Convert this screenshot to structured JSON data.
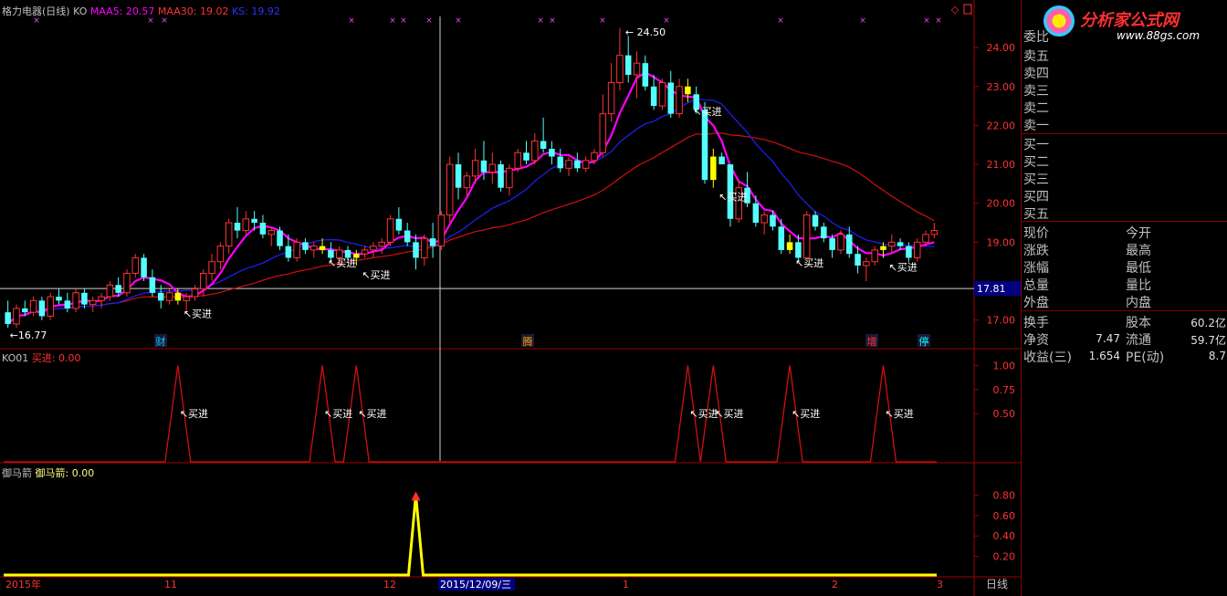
{
  "main_header": {
    "title": "格力电器(日线)",
    "formula": "KO",
    "maa5_label": "MAA5: 20.57",
    "maa30_label": "MAA30: 19.02",
    "ks_label": "KS: 19.92"
  },
  "ko_header": {
    "name": "KO01",
    "value": "买进: 0.00"
  },
  "ymj_header": {
    "name": "御马箭",
    "value": "御马箭: 0.00"
  },
  "price_axis": [
    "24.00",
    "23.00",
    "22.00",
    "21.00",
    "20.00",
    "19.00",
    "17.00"
  ],
  "current_price_tag": "17.81",
  "ko_axis": [
    "1.00",
    "0.75",
    "0.50"
  ],
  "ymj_axis": [
    "0.80",
    "0.60",
    "0.40",
    "0.20"
  ],
  "high_label": "24.50",
  "low_label": "16.77",
  "buy_label": "买进",
  "info_marks": {
    "cai": "财",
    "teng": "腾",
    "zeng": "增",
    "ting": "停"
  },
  "date_axis": {
    "start": "2015年",
    "m11": "11",
    "m12": "12",
    "cursor": "2015/12/09/三",
    "m1": "1",
    "m2": "2",
    "m3": "3",
    "period": "日线"
  },
  "orderbook": {
    "committee": "委比",
    "sells": [
      "卖五",
      "卖四",
      "卖三",
      "卖二",
      "卖一"
    ],
    "buys": [
      "买一",
      "买二",
      "买三",
      "买四",
      "买五"
    ]
  },
  "quote_rows": [
    {
      "l": "现价",
      "r": "今开"
    },
    {
      "l": "涨跌",
      "r": "最高"
    },
    {
      "l": "涨幅",
      "r": "最低"
    },
    {
      "l": "总量",
      "r": "量比"
    },
    {
      "l": "外盘",
      "r": "内盘"
    }
  ],
  "fund_rows": [
    {
      "l": "换手",
      "lv": "",
      "r": "股本",
      "rv": "60.2亿"
    },
    {
      "l": "净资",
      "lv": "7.47",
      "r": "流通",
      "rv": "59.7亿"
    },
    {
      "l": "收益(三)",
      "lv": "1.654",
      "r": "PE(动)",
      "rv": "8.7"
    }
  ],
  "logo": {
    "text": "分析家公式网",
    "url": "www.88gs.com"
  },
  "colors": {
    "up": "#ff3232",
    "down": "#54ffff",
    "maa5": "#ff00ff",
    "maa30": "#d01010",
    "ks": "#2020ff",
    "signal": "#ffff00"
  },
  "chart_data": {
    "type": "candlestick",
    "candles": [
      [
        17.2,
        17.5,
        16.8,
        16.9
      ],
      [
        16.9,
        17.4,
        16.8,
        17.3
      ],
      [
        17.3,
        17.5,
        17.1,
        17.2
      ],
      [
        17.2,
        17.6,
        17.1,
        17.5
      ],
      [
        17.5,
        17.6,
        17.0,
        17.1
      ],
      [
        17.1,
        17.7,
        17.0,
        17.6
      ],
      [
        17.6,
        17.8,
        17.4,
        17.5
      ],
      [
        17.5,
        17.7,
        17.2,
        17.3
      ],
      [
        17.3,
        17.8,
        17.2,
        17.7
      ],
      [
        17.7,
        17.8,
        17.3,
        17.4
      ],
      [
        17.4,
        17.6,
        17.2,
        17.5
      ],
      [
        17.5,
        17.7,
        17.3,
        17.6
      ],
      [
        17.6,
        18.0,
        17.5,
        17.9
      ],
      [
        17.9,
        18.1,
        17.6,
        17.7
      ],
      [
        17.7,
        18.3,
        17.6,
        18.2
      ],
      [
        18.2,
        18.7,
        18.1,
        18.6
      ],
      [
        18.6,
        18.7,
        18.0,
        18.1
      ],
      [
        18.1,
        18.3,
        17.6,
        17.7
      ],
      [
        17.7,
        17.9,
        17.3,
        17.5
      ],
      [
        17.5,
        17.8,
        17.4,
        17.7
      ],
      [
        17.7,
        17.8,
        17.4,
        17.5
      ],
      [
        17.5,
        17.7,
        17.2,
        17.6
      ],
      [
        17.6,
        17.9,
        17.5,
        17.8
      ],
      [
        17.8,
        18.3,
        17.6,
        18.2
      ],
      [
        18.2,
        18.7,
        18.0,
        18.5
      ],
      [
        18.5,
        19.0,
        18.3,
        18.9
      ],
      [
        18.9,
        19.6,
        18.7,
        19.5
      ],
      [
        19.5,
        19.9,
        19.1,
        19.3
      ],
      [
        19.3,
        19.8,
        19.2,
        19.6
      ],
      [
        19.6,
        19.8,
        19.3,
        19.5
      ],
      [
        19.5,
        19.7,
        19.1,
        19.2
      ],
      [
        19.2,
        19.4,
        18.9,
        19.3
      ],
      [
        19.3,
        19.4,
        18.8,
        18.9
      ],
      [
        18.9,
        19.2,
        18.5,
        18.6
      ],
      [
        18.6,
        19.1,
        18.5,
        19.0
      ],
      [
        19.0,
        19.1,
        18.7,
        18.8
      ],
      [
        18.8,
        19.0,
        18.6,
        18.9
      ],
      [
        18.9,
        19.1,
        18.7,
        18.8
      ],
      [
        18.8,
        19.0,
        18.5,
        18.6
      ],
      [
        18.6,
        18.9,
        18.4,
        18.8
      ],
      [
        18.8,
        18.9,
        18.5,
        18.6
      ],
      [
        18.6,
        18.8,
        18.4,
        18.7
      ],
      [
        18.7,
        18.9,
        18.6,
        18.8
      ],
      [
        18.8,
        19.0,
        18.6,
        18.9
      ],
      [
        18.9,
        19.1,
        18.7,
        19.0
      ],
      [
        19.0,
        19.7,
        18.9,
        19.6
      ],
      [
        19.6,
        19.9,
        19.2,
        19.3
      ],
      [
        19.3,
        19.5,
        18.9,
        19.0
      ],
      [
        19.0,
        19.2,
        18.3,
        18.6
      ],
      [
        18.6,
        19.2,
        18.4,
        19.1
      ],
      [
        19.1,
        19.5,
        18.6,
        18.9
      ],
      [
        18.9,
        19.8,
        18.8,
        19.7
      ],
      [
        19.7,
        21.2,
        19.5,
        21.0
      ],
      [
        21.0,
        21.3,
        20.1,
        20.4
      ],
      [
        20.4,
        20.8,
        20.2,
        20.7
      ],
      [
        20.7,
        21.4,
        20.5,
        21.1
      ],
      [
        21.1,
        21.6,
        20.6,
        20.8
      ],
      [
        20.8,
        21.3,
        20.5,
        21.0
      ],
      [
        21.0,
        21.1,
        20.3,
        20.4
      ],
      [
        20.4,
        21.0,
        20.2,
        20.9
      ],
      [
        20.9,
        21.4,
        20.8,
        21.3
      ],
      [
        21.3,
        21.6,
        21.0,
        21.1
      ],
      [
        21.1,
        21.8,
        21.0,
        21.6
      ],
      [
        21.6,
        22.2,
        21.3,
        21.4
      ],
      [
        21.4,
        21.6,
        21.0,
        21.2
      ],
      [
        21.2,
        21.4,
        20.8,
        20.9
      ],
      [
        20.9,
        21.2,
        20.7,
        21.1
      ],
      [
        21.1,
        21.3,
        20.8,
        20.9
      ],
      [
        20.9,
        21.2,
        20.8,
        21.1
      ],
      [
        21.1,
        21.4,
        21.0,
        21.3
      ],
      [
        21.3,
        22.8,
        21.2,
        22.3
      ],
      [
        22.3,
        23.6,
        22.1,
        23.1
      ],
      [
        23.1,
        24.5,
        22.9,
        23.8
      ],
      [
        23.8,
        24.3,
        23.1,
        23.3
      ],
      [
        23.3,
        23.9,
        22.7,
        23.6
      ],
      [
        23.6,
        23.8,
        22.9,
        23.0
      ],
      [
        23.0,
        23.3,
        22.4,
        22.5
      ],
      [
        22.5,
        23.2,
        22.4,
        23.1
      ],
      [
        23.1,
        23.4,
        22.2,
        22.3
      ],
      [
        22.3,
        23.2,
        22.2,
        23.0
      ],
      [
        23.0,
        23.2,
        22.6,
        22.8
      ],
      [
        22.8,
        23.0,
        22.3,
        22.4
      ],
      [
        22.4,
        22.6,
        20.5,
        20.6
      ],
      [
        20.6,
        21.4,
        20.4,
        21.2
      ],
      [
        21.2,
        21.3,
        21.0,
        21.0
      ],
      [
        21.0,
        21.0,
        19.4,
        19.6
      ],
      [
        19.6,
        20.6,
        19.5,
        20.4
      ],
      [
        20.4,
        20.8,
        19.9,
        20.0
      ],
      [
        20.0,
        20.2,
        19.4,
        19.5
      ],
      [
        19.5,
        19.8,
        19.2,
        19.7
      ],
      [
        19.7,
        19.8,
        19.3,
        19.4
      ],
      [
        19.4,
        19.6,
        18.7,
        18.8
      ],
      [
        18.8,
        19.2,
        18.7,
        19.0
      ],
      [
        19.0,
        19.2,
        18.5,
        18.6
      ],
      [
        18.6,
        19.8,
        18.6,
        19.7
      ],
      [
        19.7,
        19.8,
        19.3,
        19.4
      ],
      [
        19.4,
        19.5,
        19.0,
        19.1
      ],
      [
        19.1,
        19.2,
        18.6,
        18.8
      ],
      [
        18.8,
        19.3,
        18.7,
        19.2
      ],
      [
        19.2,
        19.4,
        18.6,
        18.7
      ],
      [
        18.7,
        18.9,
        18.2,
        18.4
      ],
      [
        18.4,
        18.6,
        18.0,
        18.5
      ],
      [
        18.5,
        18.9,
        18.4,
        18.8
      ],
      [
        18.8,
        19.0,
        18.6,
        18.9
      ],
      [
        18.9,
        19.2,
        18.7,
        19.0
      ],
      [
        19.0,
        19.1,
        18.8,
        18.9
      ],
      [
        18.9,
        19.0,
        18.5,
        18.6
      ],
      [
        18.6,
        19.1,
        18.5,
        19.0
      ],
      [
        19.0,
        19.3,
        18.9,
        19.2
      ],
      [
        19.2,
        19.5,
        19.1,
        19.3
      ]
    ],
    "price_range": [
      16.5,
      24.8
    ],
    "ko_signals": [
      20,
      37,
      41,
      80,
      83,
      92,
      103
    ],
    "ymj_signal": 48,
    "ymj_range": [
      0,
      1.0
    ]
  }
}
